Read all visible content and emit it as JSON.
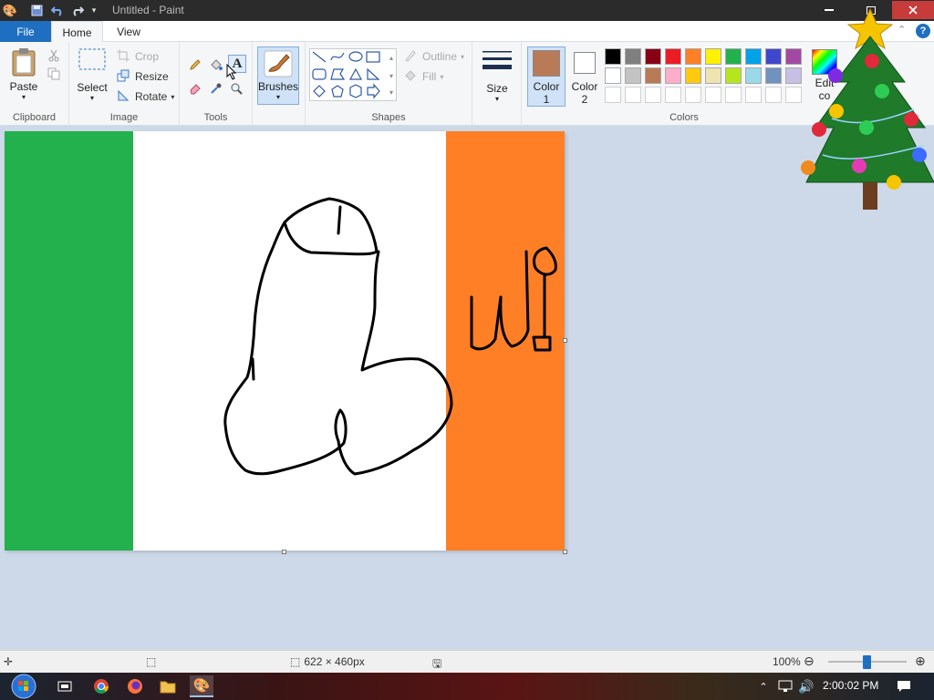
{
  "window": {
    "title": "Untitled - Paint"
  },
  "tabs": {
    "file": "File",
    "home": "Home",
    "view": "View"
  },
  "clipboard": {
    "paste": "Paste",
    "group": "Clipboard"
  },
  "image": {
    "select": "Select",
    "crop": "Crop",
    "resize": "Resize",
    "rotate": "Rotate",
    "group": "Image"
  },
  "tools": {
    "group": "Tools",
    "brushes": "Brushes"
  },
  "shapes": {
    "group": "Shapes",
    "outline": "Outline",
    "fill": "Fill",
    "size": "Size"
  },
  "colors": {
    "group": "Colors",
    "color1_label": "Color",
    "color1_num": "1",
    "color2_label": "Color",
    "color2_num": "2",
    "edit": "Edit",
    "edit2": "co",
    "color1_value": "#b97a57",
    "color2_value": "#ffffff",
    "palette_row1": [
      "#000000",
      "#7f7f7f",
      "#880015",
      "#ed1c24",
      "#ff7f27",
      "#fff200",
      "#22b14c",
      "#00a2e8",
      "#3f48cc",
      "#a349a4"
    ],
    "palette_row2": [
      "#ffffff",
      "#c3c3c3",
      "#b97a57",
      "#ffaec9",
      "#ffc90e",
      "#efe4b0",
      "#b5e61d",
      "#99d9ea",
      "#7092be",
      "#c8bfe7"
    ]
  },
  "canvas_art": {
    "flag_green": "#22b14c",
    "flag_white": "#ffffff",
    "flag_orange": "#ff7f27",
    "ink": "#000000"
  },
  "status": {
    "dimensions": "622 × 460px",
    "zoom": "100%"
  },
  "taskbar": {
    "time": "2:00:02 PM"
  }
}
